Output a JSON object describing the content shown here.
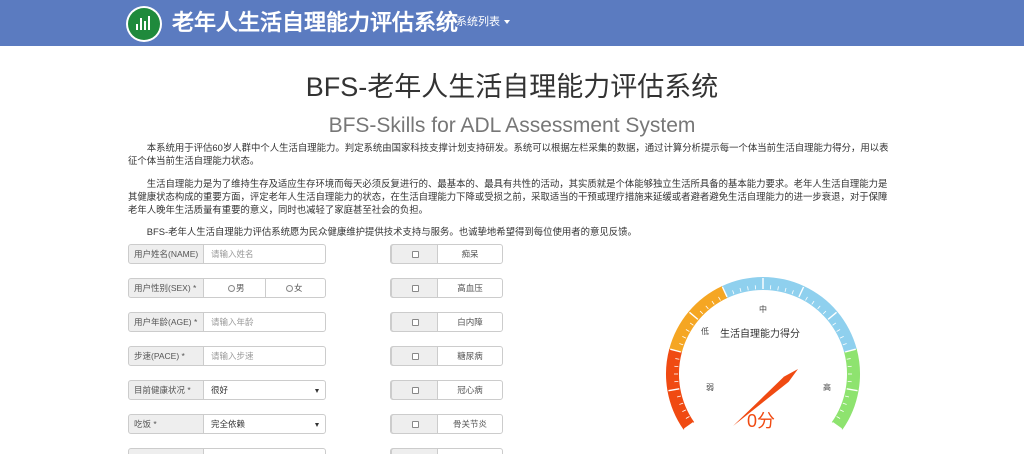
{
  "navbar": {
    "title": "老年人生活自理能力评估系统",
    "menu_label": "系统列表"
  },
  "header": {
    "title": "BFS-老年人生活自理能力评估系统",
    "subtitle": "BFS-Skills for ADL Assessment System"
  },
  "intro": {
    "p1": "本系统用于评估60岁人群中个人生活自理能力。判定系统由国家科技支撑计划支持研发。系统可以根据左栏采集的数据，通过计算分析提示每一个体当前生活自理能力得分，用以表征个体当前生活自理能力状态。",
    "p2": "生活自理能力是为了维持生存及适应生存环境而每天必须反复进行的、最基本的、最具有共性的活动，其实质就是个体能够独立生活所具备的基本能力要求。老年人生活自理能力是其健康状态构成的重要方面，评定老年人生活自理能力的状态，在生活自理能力下降或受损之前，采取适当的干预或理疗措施来延缓或者避者避免生活自理能力的进一步衰退，对于保障老年人晚年生活质量有重要的意义，同时也减轻了家庭甚至社会的负担。",
    "p3": "BFS-老年人生活自理能力评估系统愿为民众健康维护提供技术支持与服务。也诚挚地希望得到每位使用者的意见反馈。"
  },
  "form": {
    "name_label": "用户姓名(NAME)",
    "name_placeholder": "请输入姓名",
    "sex_label": "用户性别(SEX) *",
    "sex_male": "男",
    "sex_female": "女",
    "age_label": "用户年龄(AGE) *",
    "age_placeholder": "请输入年龄",
    "pace_label": "步速(PACE) *",
    "pace_placeholder": "请输入步速",
    "health_label": "目前健康状况 *",
    "health_value": "很好",
    "eat_label": "吃饭 *",
    "eat_value": "完全依赖"
  },
  "conditions": [
    "痴呆",
    "高血压",
    "白内障",
    "糖尿病",
    "冠心病",
    "骨关节炎"
  ],
  "gauge": {
    "title": "生活自理能力得分",
    "score_text": "0分",
    "score": 0,
    "label_low": "低",
    "label_weak": "弱",
    "label_mid": "中",
    "label_high": "高",
    "colors": {
      "red": "#f04a12",
      "orange": "#f5a623",
      "blue": "#8fd0ee",
      "green": "#8ee36f",
      "needle": "#f04a12"
    }
  }
}
